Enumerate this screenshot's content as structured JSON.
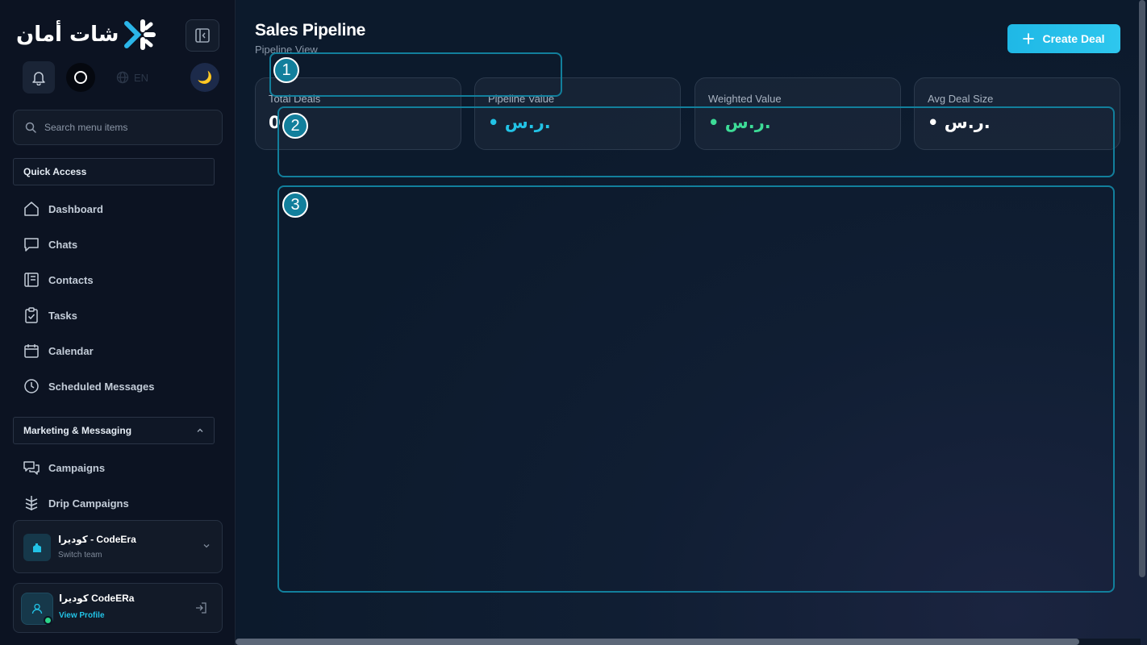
{
  "app": {
    "logo_text": "شات أمان"
  },
  "colors": {
    "accent": "#22c3e6",
    "positive": "#3ddc97",
    "overlay": "#127f9c"
  },
  "sidebar": {
    "search_placeholder": "Search menu items",
    "language_label": "EN",
    "quick_access": {
      "title": "Quick Access",
      "items": [
        {
          "label": "Dashboard",
          "icon": "home-icon"
        },
        {
          "label": "Chats",
          "icon": "chat-icon"
        },
        {
          "label": "Contacts",
          "icon": "contacts-icon"
        },
        {
          "label": "Tasks",
          "icon": "clipboard-icon"
        },
        {
          "label": "Calendar",
          "icon": "calendar-icon"
        },
        {
          "label": "Scheduled Messages",
          "icon": "clock-icon"
        }
      ]
    },
    "marketing": {
      "title": "Marketing & Messaging",
      "items": [
        {
          "label": "Campaigns",
          "icon": "campaigns-icon"
        },
        {
          "label": "Drip Campaigns",
          "icon": "drip-icon"
        }
      ]
    },
    "team": {
      "name": "كوديرا - CodeEra",
      "sub": "Switch team"
    },
    "profile": {
      "name": "كوديرا CodeERa",
      "link": "View Profile"
    }
  },
  "main": {
    "title": "Sales Pipeline",
    "subtitle": "Pipeline View",
    "create_button": "Create Deal",
    "stats": [
      {
        "label": "Total Deals",
        "value": "0"
      },
      {
        "label": "Pipeline Value",
        "value": "• ر.س."
      },
      {
        "label": "Weighted Value",
        "value": "• ر.س."
      },
      {
        "label": "Avg Deal Size",
        "value": "• ر.س."
      }
    ]
  },
  "overlays": [
    {
      "number": "1"
    },
    {
      "number": "2"
    },
    {
      "number": "3"
    }
  ]
}
